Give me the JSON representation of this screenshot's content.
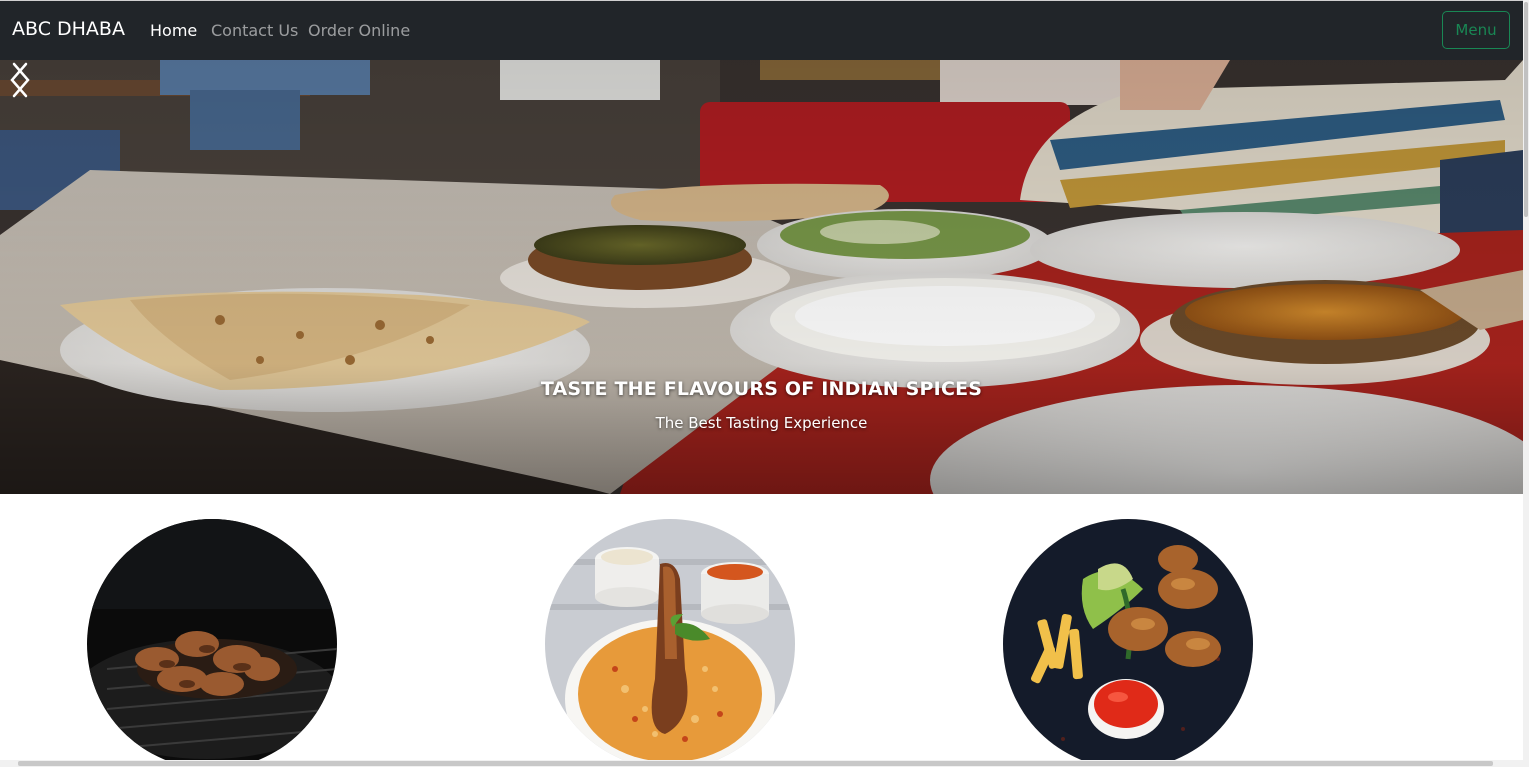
{
  "navbar": {
    "brand": "ABC DHABA",
    "links": [
      "Home",
      "Contact Us",
      "Order Online"
    ],
    "menu_button": "Menu"
  },
  "hero": {
    "title": "TASTE THE FLAVOURS OF INDIAN SPICES",
    "subtitle": "The Best Tasting Experience",
    "prev_icon": "chevron-left-icon",
    "next_icon": "chevron-right-icon"
  },
  "featured": {
    "images": [
      "grilled-chicken-image",
      "chicken-biryani-image",
      "fried-chicken-platter-image"
    ]
  },
  "colors": {
    "navbar_bg": "#212529",
    "menu_button_accent": "#198754"
  }
}
